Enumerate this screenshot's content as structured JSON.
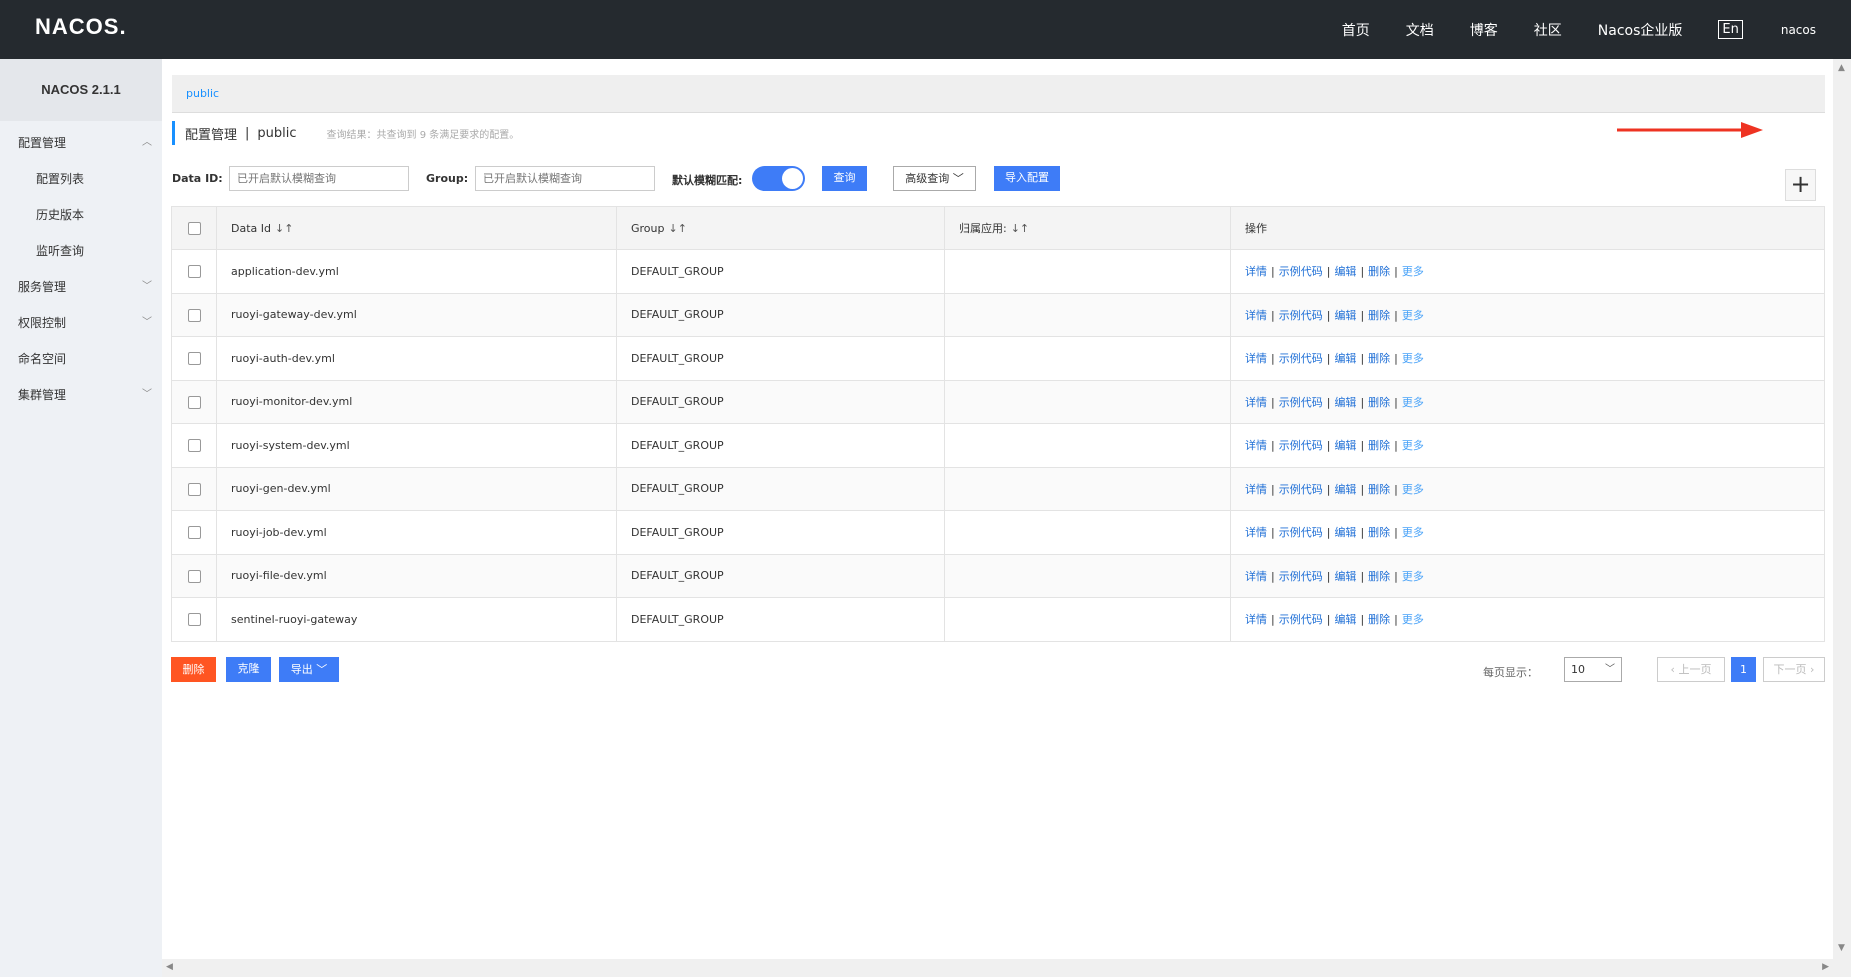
{
  "topbar": {
    "logo": "NACOS.",
    "nav": [
      "首页",
      "文档",
      "博客",
      "社区",
      "Nacos企业版"
    ],
    "lang": "En",
    "user": "nacos"
  },
  "sidebar": {
    "title": "NACOS 2.1.1",
    "items": [
      {
        "label": "配置管理",
        "chevron": "chevron-up-icon"
      },
      {
        "label": "配置列表"
      },
      {
        "label": "历史版本"
      },
      {
        "label": "监听查询"
      },
      {
        "label": "服务管理",
        "chevron": "chevron-down-icon"
      },
      {
        "label": "权限控制",
        "chevron": "chevron-down-icon"
      },
      {
        "label": "命名空间"
      },
      {
        "label": "集群管理",
        "chevron": "chevron-down-icon"
      }
    ]
  },
  "namespace_bar": "public",
  "header": {
    "title": "配置管理",
    "separator": "|",
    "namespace": "public",
    "result": "查询结果：共查询到 9 条满足要求的配置。"
  },
  "filter": {
    "dataid_label": "Data ID:",
    "dataid_placeholder": "已开启默认模糊查询",
    "group_label": "Group:",
    "group_placeholder": "已开启默认模糊查询",
    "fuzzy_label": "默认模糊匹配:",
    "fuzzy_on": true,
    "search_button": "查询",
    "advanced_button": "高级查询",
    "import_button": "导入配置"
  },
  "add_button": "+",
  "table": {
    "columns": [
      "Data Id",
      "Group",
      "归属应用:",
      "操作"
    ],
    "rows": [
      {
        "data_id": "application-dev.yml",
        "group": "DEFAULT_GROUP",
        "app": ""
      },
      {
        "data_id": "ruoyi-gateway-dev.yml",
        "group": "DEFAULT_GROUP",
        "app": ""
      },
      {
        "data_id": "ruoyi-auth-dev.yml",
        "group": "DEFAULT_GROUP",
        "app": ""
      },
      {
        "data_id": "ruoyi-monitor-dev.yml",
        "group": "DEFAULT_GROUP",
        "app": ""
      },
      {
        "data_id": "ruoyi-system-dev.yml",
        "group": "DEFAULT_GROUP",
        "app": ""
      },
      {
        "data_id": "ruoyi-gen-dev.yml",
        "group": "DEFAULT_GROUP",
        "app": ""
      },
      {
        "data_id": "ruoyi-job-dev.yml",
        "group": "DEFAULT_GROUP",
        "app": ""
      },
      {
        "data_id": "ruoyi-file-dev.yml",
        "group": "DEFAULT_GROUP",
        "app": ""
      },
      {
        "data_id": "sentinel-ruoyi-gateway",
        "group": "DEFAULT_GROUP",
        "app": ""
      }
    ],
    "actions": [
      "详情",
      "示例代码",
      "编辑",
      "删除",
      "更多"
    ]
  },
  "footer": {
    "delete_button": "删除",
    "clone_button": "克隆",
    "export_button": "导出",
    "page_size_label": "每页显示：",
    "page_size": "10",
    "prev": "上一页",
    "current_page": "1",
    "next": "下一页"
  },
  "colors": {
    "topbar": "#252a2f",
    "primary": "#3e7cf7",
    "danger": "#ff5522",
    "sidebar": "#eef1f5"
  }
}
